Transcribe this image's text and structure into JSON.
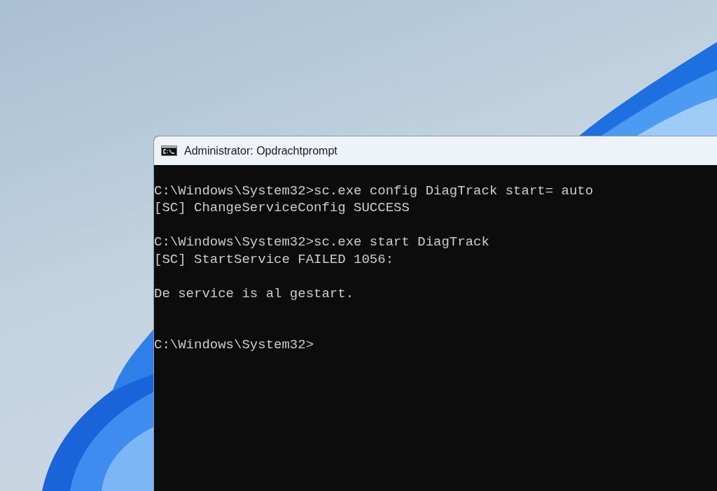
{
  "window": {
    "title": "Administrator: Opdrachtprompt"
  },
  "console": {
    "lines": [
      {
        "kind": "command",
        "text": "C:\\Windows\\System32>sc.exe config DiagTrack start= auto"
      },
      {
        "kind": "output",
        "text": "[SC] ChangeServiceConfig SUCCESS"
      },
      {
        "kind": "command",
        "text": "C:\\Windows\\System32>sc.exe start DiagTrack"
      },
      {
        "kind": "output",
        "text": "[SC] StartService FAILED 1056:"
      },
      {
        "kind": "message",
        "text": "De service is al gestart."
      },
      {
        "kind": "prompt",
        "text": "C:\\Windows\\System32>"
      }
    ]
  }
}
